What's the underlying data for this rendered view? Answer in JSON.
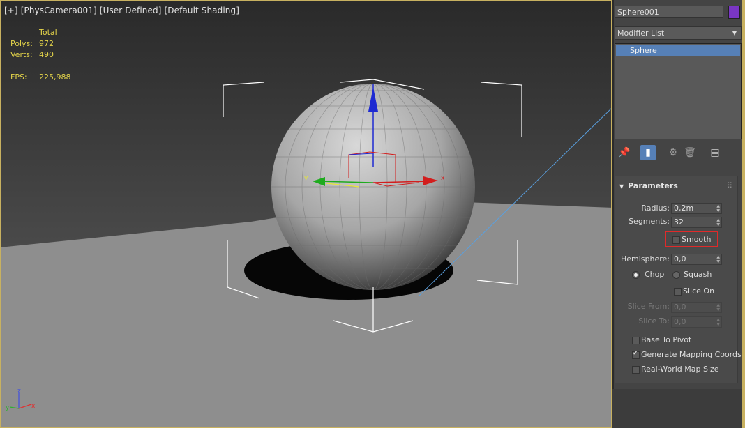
{
  "viewport": {
    "label_parts": [
      "[+]",
      "[PhysCamera001]",
      "[User Defined]",
      "[Default Shading]"
    ],
    "stats": {
      "header": "Total",
      "polys_label": "Polys:",
      "polys_value": "972",
      "verts_label": "Verts:",
      "verts_value": "490",
      "fps_label": "FPS:",
      "fps_value": "225,988"
    },
    "axis_labels": {
      "x": "x",
      "y": "y",
      "z": "z"
    },
    "colors": {
      "stats": "#e4d44a",
      "gizmo_x": "#d21e1e",
      "gizmo_y": "#1eab1e",
      "gizmo_z": "#1e2ad2",
      "active_border": "#c8b160"
    }
  },
  "panel": {
    "object_name": "Sphere001",
    "object_color": "#7a36c4",
    "modifier_list": "Modifier List",
    "modifier_stack": [
      "Sphere"
    ],
    "tools": [
      "pin-stack-icon",
      "show-end-result-icon",
      "make-unique-icon",
      "remove-modifier-icon",
      "configure-modifier-sets-icon"
    ],
    "parameters": {
      "title": "Parameters",
      "radius_label": "Radius:",
      "radius_value": "0,2m",
      "segments_label": "Segments:",
      "segments_value": "32",
      "smooth_label": "Smooth",
      "smooth_checked": false,
      "hemisphere_label": "Hemisphere:",
      "hemisphere_value": "0,0",
      "chop_label": "Chop",
      "squash_label": "Squash",
      "mode_selected": "Chop",
      "slice_on_label": "Slice On",
      "slice_on_checked": false,
      "slice_from_label": "Slice From:",
      "slice_from_value": "0,0",
      "slice_to_label": "Slice To:",
      "slice_to_value": "0,0",
      "base_to_pivot_label": "Base To Pivot",
      "base_to_pivot_checked": false,
      "gen_mapping_label": "Generate Mapping Coords.",
      "gen_mapping_checked": true,
      "real_world_label": "Real-World Map Size",
      "real_world_checked": false
    },
    "colors": {
      "selection": "#5680b7",
      "highlight": "#e02a2a"
    }
  }
}
